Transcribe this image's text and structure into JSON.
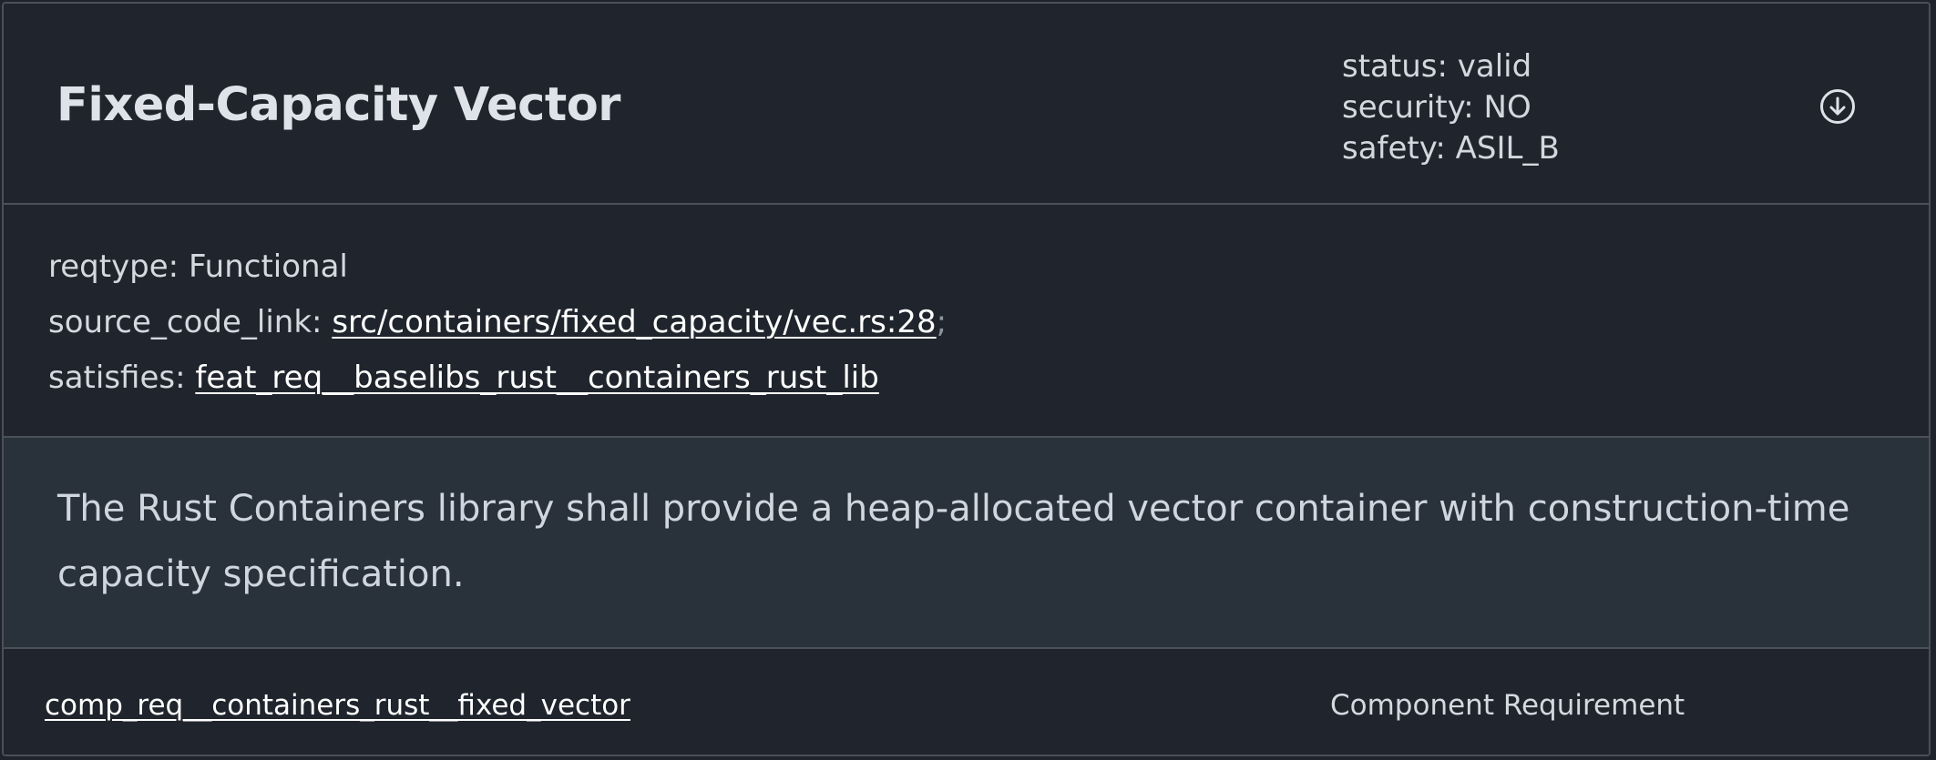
{
  "need": {
    "title": "Fixed-Capacity Vector",
    "meta": {
      "status": "status: valid",
      "security": "security: NO",
      "safety": "safety: ASIL_B"
    },
    "toggle_icon": "chevron-down-circle-icon",
    "options": {
      "reqtype_label": "reqtype:",
      "reqtype_value": "Functional",
      "source_code_link_label": "source_code_link:",
      "source_code_link_value": "src/containers/fixed_capacity/vec.rs:28",
      "source_code_link_separator": ";",
      "satisfies_label": "satisfies:",
      "satisfies_value": "feat_req__baselibs_rust__containers_rust_lib"
    },
    "content": "The Rust Containers library shall provide a heap-allocated vector container with construction-time capacity specification.",
    "footer": {
      "id": "comp_req__containers_rust__fixed_vector",
      "type": "Component Requirement"
    }
  },
  "colors": {
    "background": "#20252d",
    "content_background": "#29313b",
    "border": "#4b5159",
    "text": "#d4d9e0",
    "link": "#ffffff"
  }
}
